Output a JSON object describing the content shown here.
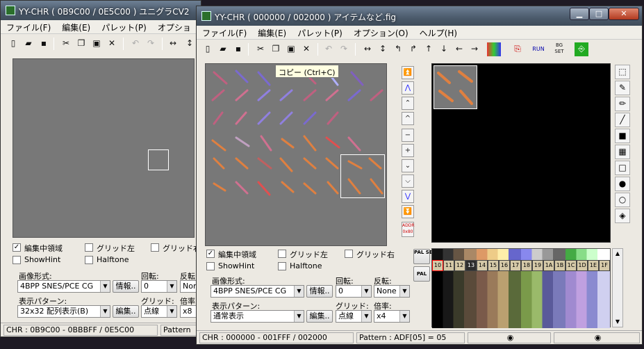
{
  "back_window": {
    "title": "YY-CHR ( 0B9C00 / 0E5C00 ) ユニグラCV2",
    "menu": [
      "ファイル(F)",
      "編集(E)",
      "パレット(P)",
      "オプショ"
    ],
    "edit_area_label": "編集中領域",
    "grid_left_label": "グリッド左",
    "grid_right_label": "グリッド右",
    "showhint_label": "ShowHint",
    "halftone_label": "Halftone",
    "format_label": "画像形式:",
    "format_value": "4BPP SNES/PCE CG",
    "info_button": "情報..",
    "rotate_label": "回転:",
    "rotate_value": "0",
    "flip_label": "反転",
    "flip_value": "Non",
    "pattern_label": "表示パターン:",
    "pattern_value": "32x32 配列表示(B)",
    "edit_button": "編集..",
    "grid_label": "グリッド:",
    "grid_value": "点線",
    "zoom_label": "倍率",
    "zoom_value": "x8",
    "status_chr": "CHR : 0B9C00 - 0BBBFF / 0E5C00",
    "status_pattern": "Pattern"
  },
  "main_window": {
    "title": "YY-CHR ( 000000 / 002000 ) アイテムなど.fig",
    "menu": [
      "ファイル(F)",
      "編集(E)",
      "パレット(P)",
      "オプション(O)",
      "ヘルプ(H)"
    ],
    "tooltip": "コピー (Ctrl+C)",
    "edit_area_label": "編集中領域",
    "grid_left_label": "グリッド左",
    "grid_right_label": "グリッド右",
    "showhint_label": "ShowHint",
    "halftone_label": "Halftone",
    "format_label": "画像形式:",
    "format_value": "4BPP SNES/PCE CG",
    "info_button": "情報..",
    "rotate_label": "回転:",
    "rotate_value": "0",
    "flip_label": "反転:",
    "flip_value": "None",
    "pattern_label": "表示パターン:",
    "pattern_value": "通常表示",
    "edit_button": "編集..",
    "grid_label": "グリッド:",
    "grid_value": "点線",
    "zoom_label": "倍率:",
    "zoom_value": "x4",
    "addr_label": "ADDR 0x80",
    "pal_set_label": "PAL SET",
    "pal_label": "PAL",
    "palette_row_labels": [
      "10",
      "11",
      "12",
      "13",
      "14",
      "15",
      "16",
      "17",
      "18",
      "19",
      "1A",
      "1B",
      "1C",
      "1D",
      "1E",
      "1F"
    ],
    "status_chr": "CHR : 000000 - 001FFF / 002000",
    "status_pattern": "Pattern : ADF[05] = 05"
  },
  "colors": {
    "titlebar": "#4b5a6b",
    "sprite_bg": "#787878",
    "edit_bg": "#000000",
    "selection": "#ffffff",
    "palette_highlight": "#ff0000"
  }
}
